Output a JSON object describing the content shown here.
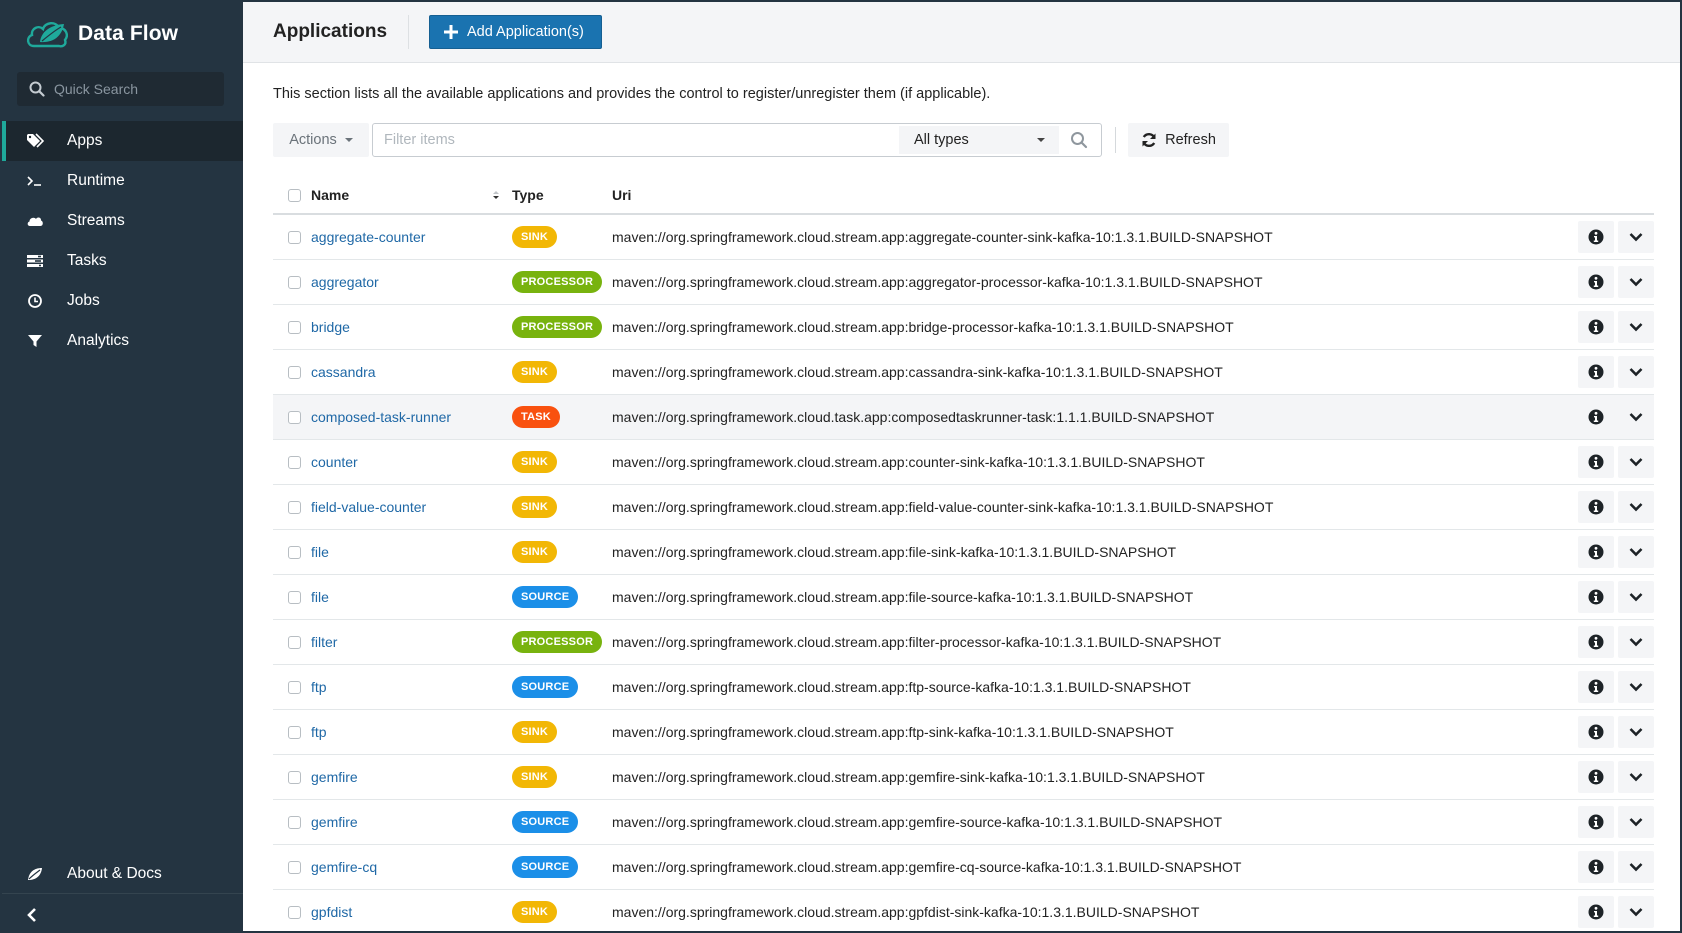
{
  "sidebar": {
    "brand": "Data Flow",
    "quick_search_placeholder": "Quick Search",
    "items": [
      {
        "label": "Apps",
        "icon": "tags-icon",
        "active": true
      },
      {
        "label": "Runtime",
        "icon": "terminal-icon",
        "active": false
      },
      {
        "label": "Streams",
        "icon": "cloud-icon",
        "active": false
      },
      {
        "label": "Tasks",
        "icon": "tasks-icon",
        "active": false
      },
      {
        "label": "Jobs",
        "icon": "clock-icon",
        "active": false
      },
      {
        "label": "Analytics",
        "icon": "filter-icon",
        "active": false
      }
    ],
    "about_label": "About & Docs",
    "accent_color": "#1fa99b"
  },
  "header": {
    "title": "Applications",
    "add_button_label": "Add Application(s)"
  },
  "description": "This section lists all the available applications and provides the control to register/unregister them (if applicable).",
  "toolbar": {
    "actions_label": "Actions",
    "filter_placeholder": "Filter items",
    "filter_value": "",
    "type_select_value": "All types",
    "refresh_label": "Refresh"
  },
  "table": {
    "columns": [
      "Name",
      "Type",
      "Uri"
    ],
    "badge_colors": {
      "SINK": "#f2b705",
      "PROCESSOR": "#78b30e",
      "SOURCE": "#1b8fe8",
      "TASK": "#f9510f"
    },
    "rows": [
      {
        "name": "aggregate-counter",
        "type": "SINK",
        "uri": "maven://org.springframework.cloud.stream.app:aggregate-counter-sink-kafka-10:1.3.1.BUILD-SNAPSHOT"
      },
      {
        "name": "aggregator",
        "type": "PROCESSOR",
        "uri": "maven://org.springframework.cloud.stream.app:aggregator-processor-kafka-10:1.3.1.BUILD-SNAPSHOT"
      },
      {
        "name": "bridge",
        "type": "PROCESSOR",
        "uri": "maven://org.springframework.cloud.stream.app:bridge-processor-kafka-10:1.3.1.BUILD-SNAPSHOT"
      },
      {
        "name": "cassandra",
        "type": "SINK",
        "uri": "maven://org.springframework.cloud.stream.app:cassandra-sink-kafka-10:1.3.1.BUILD-SNAPSHOT"
      },
      {
        "name": "composed-task-runner",
        "type": "TASK",
        "uri": "maven://org.springframework.cloud.task.app:composedtaskrunner-task:1.1.1.BUILD-SNAPSHOT",
        "hover": true
      },
      {
        "name": "counter",
        "type": "SINK",
        "uri": "maven://org.springframework.cloud.stream.app:counter-sink-kafka-10:1.3.1.BUILD-SNAPSHOT"
      },
      {
        "name": "field-value-counter",
        "type": "SINK",
        "uri": "maven://org.springframework.cloud.stream.app:field-value-counter-sink-kafka-10:1.3.1.BUILD-SNAPSHOT"
      },
      {
        "name": "file",
        "type": "SINK",
        "uri": "maven://org.springframework.cloud.stream.app:file-sink-kafka-10:1.3.1.BUILD-SNAPSHOT"
      },
      {
        "name": "file",
        "type": "SOURCE",
        "uri": "maven://org.springframework.cloud.stream.app:file-source-kafka-10:1.3.1.BUILD-SNAPSHOT"
      },
      {
        "name": "filter",
        "type": "PROCESSOR",
        "uri": "maven://org.springframework.cloud.stream.app:filter-processor-kafka-10:1.3.1.BUILD-SNAPSHOT"
      },
      {
        "name": "ftp",
        "type": "SOURCE",
        "uri": "maven://org.springframework.cloud.stream.app:ftp-source-kafka-10:1.3.1.BUILD-SNAPSHOT"
      },
      {
        "name": "ftp",
        "type": "SINK",
        "uri": "maven://org.springframework.cloud.stream.app:ftp-sink-kafka-10:1.3.1.BUILD-SNAPSHOT"
      },
      {
        "name": "gemfire",
        "type": "SINK",
        "uri": "maven://org.springframework.cloud.stream.app:gemfire-sink-kafka-10:1.3.1.BUILD-SNAPSHOT"
      },
      {
        "name": "gemfire",
        "type": "SOURCE",
        "uri": "maven://org.springframework.cloud.stream.app:gemfire-source-kafka-10:1.3.1.BUILD-SNAPSHOT"
      },
      {
        "name": "gemfire-cq",
        "type": "SOURCE",
        "uri": "maven://org.springframework.cloud.stream.app:gemfire-cq-source-kafka-10:1.3.1.BUILD-SNAPSHOT"
      },
      {
        "name": "gpfdist",
        "type": "SINK",
        "uri": "maven://org.springframework.cloud.stream.app:gpfdist-sink-kafka-10:1.3.1.BUILD-SNAPSHOT"
      }
    ]
  }
}
